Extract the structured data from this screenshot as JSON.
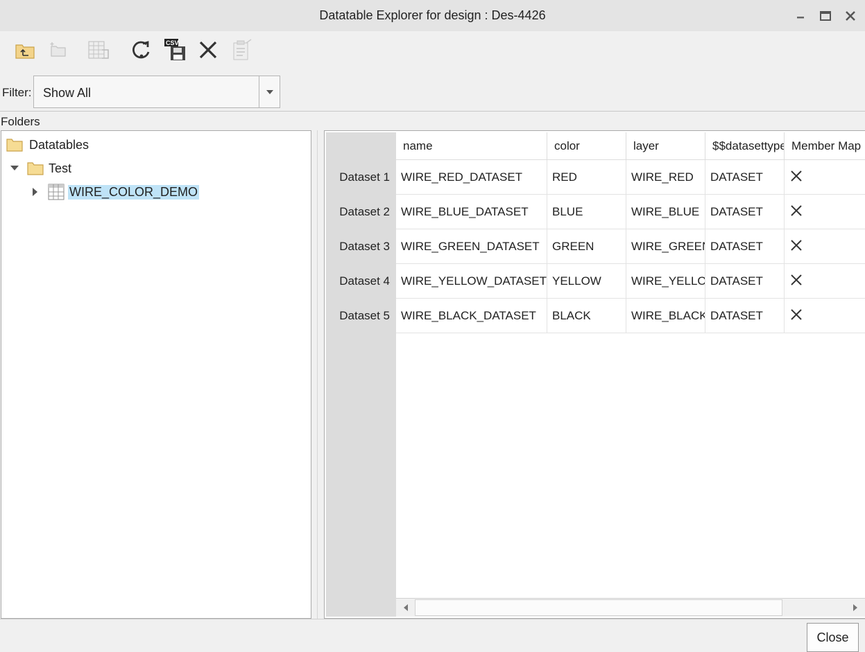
{
  "window": {
    "title": "Datatable Explorer for design : Des-4426"
  },
  "toolbar": {
    "icons": [
      "folder-up-icon",
      "new-folder-icon",
      "table-export-icon",
      "refresh-icon",
      "csv-save-icon",
      "delete-icon",
      "properties-icon"
    ]
  },
  "filter": {
    "label": "Filter:",
    "value": "Show All"
  },
  "folders": {
    "label": "Folders",
    "root": "Datatables",
    "child": "Test",
    "leaf": "WIRE_COLOR_DEMO"
  },
  "grid": {
    "columns": [
      "name",
      "color",
      "layer",
      "$$datasettype",
      "Member Map"
    ],
    "rows": [
      {
        "header": "Dataset 1",
        "name": "WIRE_RED_DATASET",
        "color": "RED",
        "layer": "WIRE_RED",
        "type": "DATASET"
      },
      {
        "header": "Dataset 2",
        "name": "WIRE_BLUE_DATASET",
        "color": "BLUE",
        "layer": "WIRE_BLUE",
        "type": "DATASET"
      },
      {
        "header": "Dataset 3",
        "name": "WIRE_GREEN_DATASET",
        "color": "GREEN",
        "layer": "WIRE_GREEN",
        "type": "DATASET"
      },
      {
        "header": "Dataset 4",
        "name": "WIRE_YELLOW_DATASET",
        "color": "YELLOW",
        "layer": "WIRE_YELLOW",
        "type": "DATASET"
      },
      {
        "header": "Dataset 5",
        "name": "WIRE_BLACK_DATASET",
        "color": "BLACK",
        "layer": "WIRE_BLACK",
        "type": "DATASET"
      }
    ]
  },
  "footer": {
    "close_label": "Close"
  },
  "colors": {
    "selection": "#bfe3f7",
    "row_header_bg": "#dcdcdc",
    "titlebar_bg": "#e4e4e4"
  }
}
